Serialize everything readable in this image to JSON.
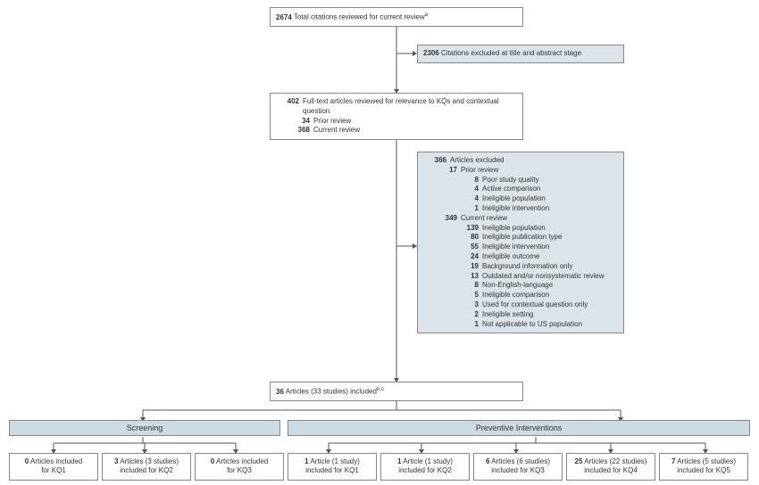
{
  "top": {
    "total_n": "2674",
    "total_label": "Total citations reviewed for current review",
    "total_sup": "a"
  },
  "excluded_title_abs": {
    "n": "2306",
    "label": "Citations excluded at title and abstract stage"
  },
  "fulltext": {
    "n": "402",
    "label": "Full-text articles reviewed for relevance to KQs and contextual question",
    "prior_n": "34",
    "prior_label": "Prior review",
    "current_n": "368",
    "current_label": "Current review"
  },
  "excluded_detail": {
    "n": "366",
    "label": "Articles excluded",
    "prior_n": "17",
    "prior_label": "Prior review",
    "prior_items": [
      {
        "n": "8",
        "label": "Poor study quality"
      },
      {
        "n": "4",
        "label": "Active comparison"
      },
      {
        "n": "4",
        "label": "Ineligible population"
      },
      {
        "n": "1",
        "label": "Ineligible intervention"
      }
    ],
    "current_n": "349",
    "current_label": "Current review",
    "current_items": [
      {
        "n": "139",
        "label": "Ineligible population"
      },
      {
        "n": "80",
        "label": "Ineligible publication type"
      },
      {
        "n": "55",
        "label": "Ineligible intervention"
      },
      {
        "n": "24",
        "label": "Ineligible outcome"
      },
      {
        "n": "19",
        "label": "Background information only"
      },
      {
        "n": "13",
        "label": "Outdated and/or nonsystematic review"
      },
      {
        "n": "8",
        "label": "Non-English-language"
      },
      {
        "n": "5",
        "label": "Ineligible comparison"
      },
      {
        "n": "3",
        "label": "Used for contextual question only"
      },
      {
        "n": "2",
        "label": "Ineligible setting"
      },
      {
        "n": "1",
        "label": "Not applicable to US population"
      }
    ]
  },
  "included": {
    "n": "36",
    "label": "Articles (33 studies) included",
    "sup": "b,c"
  },
  "bands": {
    "screening": "Screening",
    "preventive": "Preventive Interventions"
  },
  "kq": [
    {
      "b": "0",
      "line1": "Articles included",
      "line2": "for KQ1"
    },
    {
      "b": "3",
      "line1": "Articles (3 studies)",
      "line2": "included for KQ2"
    },
    {
      "b": "0",
      "line1": "Articles included",
      "line2": "for KQ3"
    },
    {
      "b": "1",
      "line1": "Article (1 study)",
      "line2": "included for KQ1"
    },
    {
      "b": "1",
      "line1": "Article (1 study)",
      "line2": "included for KQ2"
    },
    {
      "b": "6",
      "line1": "Articles (6 studies)",
      "line2": "included for KQ3"
    },
    {
      "b": "25",
      "line1": "Articles (22 studies)",
      "line2": "included for KQ4"
    },
    {
      "b": "7",
      "line1": "Articles (5 studies)",
      "line2": "included for KQ5"
    }
  ]
}
